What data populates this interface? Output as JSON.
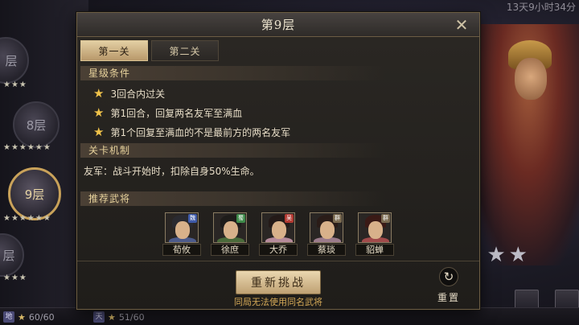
{
  "background": {
    "floors": [
      {
        "label": "层"
      },
      {
        "label": "8层"
      },
      {
        "label": "9层"
      },
      {
        "label": "层"
      }
    ],
    "stars_row_1": "★★★",
    "stars_row_2": "★★★★★★",
    "stars_row_3": "★★★★★★",
    "stars_row_4": "★★★",
    "top_right_text": "13天9小时34分",
    "right_stars": "★★",
    "bottom_left": {
      "tag": "地",
      "value": "60/60"
    },
    "bottom_mid": {
      "tag": "天",
      "value": "51/60"
    }
  },
  "modal": {
    "title": "第9层",
    "close_icon": "close-x",
    "tabs": [
      {
        "label": "第一关",
        "active": true
      },
      {
        "label": "第二关",
        "active": false
      }
    ],
    "star_conditions_title": "星级条件",
    "star_conditions": [
      {
        "text": "3回合内过关"
      },
      {
        "text": "第1回合，回复两名友军至满血"
      },
      {
        "text": "第1个回复至满血的不是最前方的两名友军"
      }
    ],
    "mechanism_title": "关卡机制",
    "mechanism_text": "友军：战斗开始时，扣除自身50%生命。",
    "recommend_title": "推荐武将",
    "generals": [
      {
        "name": "荀攸",
        "faction": "魏",
        "faction_color": "#3f5aa8",
        "hair": "#2a2a30",
        "robe": "#4c5a8a"
      },
      {
        "name": "徐庶",
        "faction": "蜀",
        "faction_color": "#3f8a4a",
        "hair": "#1e1c1a",
        "robe": "#4a6a3a"
      },
      {
        "name": "大乔",
        "faction": "吴",
        "faction_color": "#b33a32",
        "hair": "#241a18",
        "robe": "#b58a9a"
      },
      {
        "name": "蔡琰",
        "faction": "群",
        "faction_color": "#7a6a50",
        "hair": "#2a1c18",
        "robe": "#9a7a8a"
      },
      {
        "name": "貂蝉",
        "faction": "群",
        "faction_color": "#7a6a50",
        "hair": "#3a1a16",
        "robe": "#a04a4a"
      }
    ],
    "challenge_button": "重新挑战",
    "challenge_note": "同局无法使用同名武将",
    "reset_label": "重置",
    "reset_icon": "refresh"
  }
}
